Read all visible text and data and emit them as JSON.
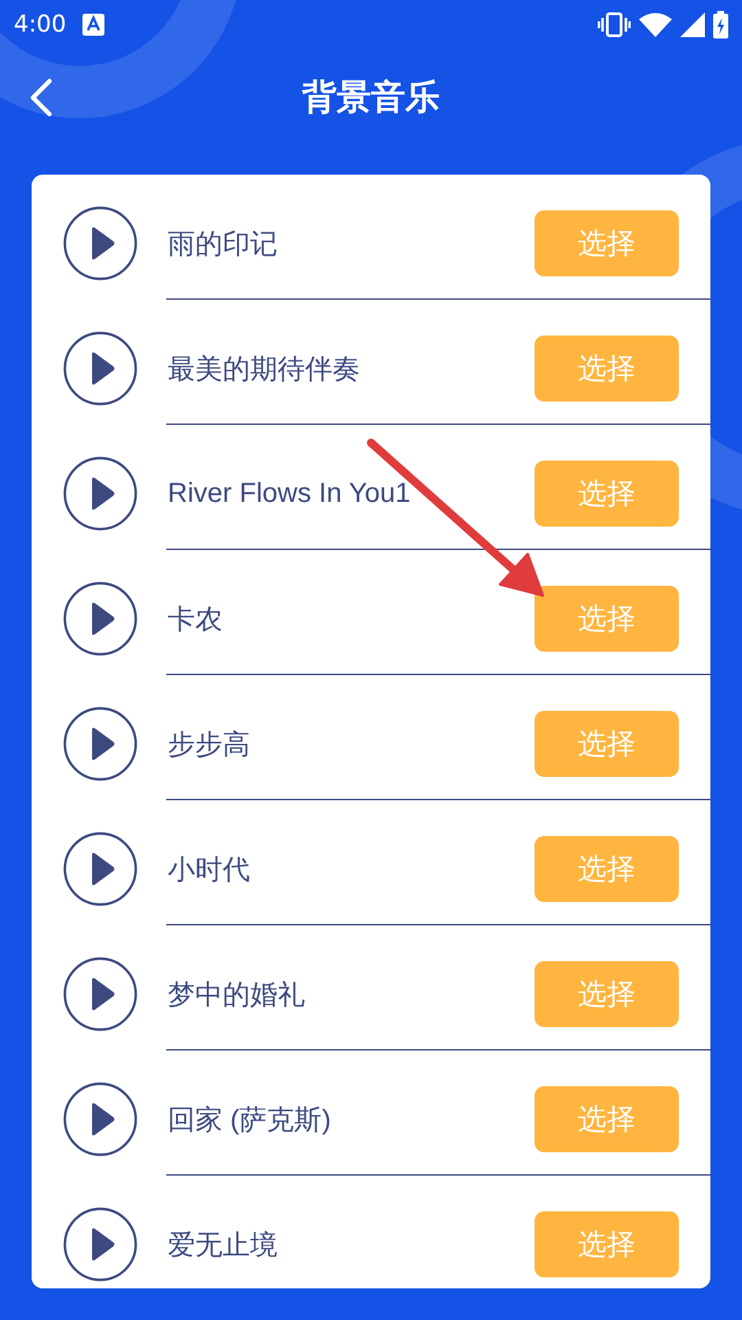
{
  "status_bar": {
    "time": "4:00"
  },
  "header": {
    "title": "背景音乐"
  },
  "tracks": [
    {
      "title": "雨的印记",
      "button": "选择"
    },
    {
      "title": "最美的期待伴奏",
      "button": "选择"
    },
    {
      "title": "River Flows In You1",
      "button": "选择"
    },
    {
      "title": "卡农",
      "button": "选择"
    },
    {
      "title": "步步高",
      "button": "选择"
    },
    {
      "title": "小时代",
      "button": "选择"
    },
    {
      "title": "梦中的婚礼",
      "button": "选择"
    },
    {
      "title": "回家 (萨克斯)",
      "button": "选择"
    },
    {
      "title": "爱无止境",
      "button": "选择"
    }
  ]
}
